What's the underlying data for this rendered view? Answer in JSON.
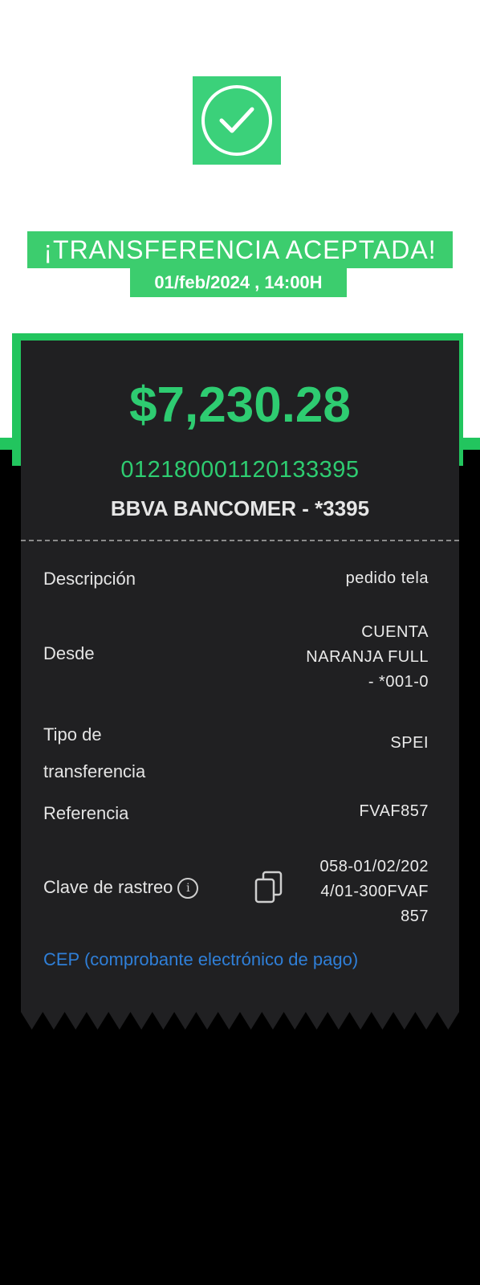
{
  "status": {
    "title": "¡TRANSFERENCIA ACEPTADA!",
    "datetime": "01/feb/2024 , 14:00H",
    "icon": "check-circle-icon"
  },
  "transfer": {
    "amount": "$7,230.28",
    "account_number": "012180001120133395",
    "bank": "BBVA BANCOMER - *3395"
  },
  "details": {
    "descripcion": {
      "label": "Descripción",
      "value": "pedido tela"
    },
    "desde": {
      "label": "Desde",
      "value_lines": [
        "CUENTA",
        "NARANJA FULL",
        "- *001-0"
      ]
    },
    "tipo": {
      "label_lines": [
        "Tipo de",
        "transferencia"
      ],
      "value": "SPEI"
    },
    "referencia": {
      "label": "Referencia",
      "value": "FVAF857"
    },
    "clave": {
      "label": "Clave de rastreo",
      "value_lines": [
        "058-01/02/202",
        "4/01-300FVAF",
        "857"
      ]
    }
  },
  "cep_link": "CEP (comprobante electrónico de pago)",
  "colors": {
    "accent_green": "#2ecc71",
    "band_green": "#22c55e",
    "link_blue": "#2f7fd8",
    "receipt_bg": "#202022"
  }
}
